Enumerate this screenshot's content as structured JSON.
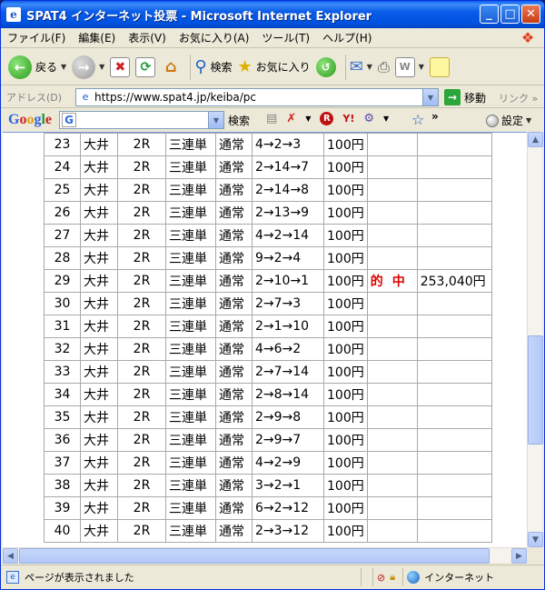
{
  "window": {
    "title": "SPAT4 インターネット投票 - Microsoft Internet Explorer"
  },
  "menubar": {
    "items": [
      "ファイル(F)",
      "編集(E)",
      "表示(V)",
      "お気に入り(A)",
      "ツール(T)",
      "ヘルプ(H)"
    ]
  },
  "toolbar": {
    "back": "戻る",
    "search": "検索",
    "favorites": "お気に入り"
  },
  "address": {
    "label": "アドレス(D)",
    "url": "https://www.spat4.jp/keiba/pc",
    "go": "移動",
    "links": "リンク"
  },
  "google": {
    "logo": "Google",
    "search_button": "検索",
    "settings": "設定"
  },
  "bets": {
    "rows": [
      {
        "num": "23",
        "track": "大井",
        "race": "2R",
        "type": "三連単",
        "mode": "通常",
        "combo": "4→2→3",
        "amount": "100円",
        "hit": "",
        "payout": ""
      },
      {
        "num": "24",
        "track": "大井",
        "race": "2R",
        "type": "三連単",
        "mode": "通常",
        "combo": "2→14→7",
        "amount": "100円",
        "hit": "",
        "payout": ""
      },
      {
        "num": "25",
        "track": "大井",
        "race": "2R",
        "type": "三連単",
        "mode": "通常",
        "combo": "2→14→8",
        "amount": "100円",
        "hit": "",
        "payout": ""
      },
      {
        "num": "26",
        "track": "大井",
        "race": "2R",
        "type": "三連単",
        "mode": "通常",
        "combo": "2→13→9",
        "amount": "100円",
        "hit": "",
        "payout": ""
      },
      {
        "num": "27",
        "track": "大井",
        "race": "2R",
        "type": "三連単",
        "mode": "通常",
        "combo": "4→2→14",
        "amount": "100円",
        "hit": "",
        "payout": ""
      },
      {
        "num": "28",
        "track": "大井",
        "race": "2R",
        "type": "三連単",
        "mode": "通常",
        "combo": "9→2→4",
        "amount": "100円",
        "hit": "",
        "payout": ""
      },
      {
        "num": "29",
        "track": "大井",
        "race": "2R",
        "type": "三連単",
        "mode": "通常",
        "combo": "2→10→1",
        "amount": "100円",
        "hit": "的中",
        "payout": "253,040円"
      },
      {
        "num": "30",
        "track": "大井",
        "race": "2R",
        "type": "三連単",
        "mode": "通常",
        "combo": "2→7→3",
        "amount": "100円",
        "hit": "",
        "payout": ""
      },
      {
        "num": "31",
        "track": "大井",
        "race": "2R",
        "type": "三連単",
        "mode": "通常",
        "combo": "2→1→10",
        "amount": "100円",
        "hit": "",
        "payout": ""
      },
      {
        "num": "32",
        "track": "大井",
        "race": "2R",
        "type": "三連単",
        "mode": "通常",
        "combo": "4→6→2",
        "amount": "100円",
        "hit": "",
        "payout": ""
      },
      {
        "num": "33",
        "track": "大井",
        "race": "2R",
        "type": "三連単",
        "mode": "通常",
        "combo": "2→7→14",
        "amount": "100円",
        "hit": "",
        "payout": ""
      },
      {
        "num": "34",
        "track": "大井",
        "race": "2R",
        "type": "三連単",
        "mode": "通常",
        "combo": "2→8→14",
        "amount": "100円",
        "hit": "",
        "payout": ""
      },
      {
        "num": "35",
        "track": "大井",
        "race": "2R",
        "type": "三連単",
        "mode": "通常",
        "combo": "2→9→8",
        "amount": "100円",
        "hit": "",
        "payout": ""
      },
      {
        "num": "36",
        "track": "大井",
        "race": "2R",
        "type": "三連単",
        "mode": "通常",
        "combo": "2→9→7",
        "amount": "100円",
        "hit": "",
        "payout": ""
      },
      {
        "num": "37",
        "track": "大井",
        "race": "2R",
        "type": "三連単",
        "mode": "通常",
        "combo": "4→2→9",
        "amount": "100円",
        "hit": "",
        "payout": ""
      },
      {
        "num": "38",
        "track": "大井",
        "race": "2R",
        "type": "三連単",
        "mode": "通常",
        "combo": "3→2→1",
        "amount": "100円",
        "hit": "",
        "payout": ""
      },
      {
        "num": "39",
        "track": "大井",
        "race": "2R",
        "type": "三連単",
        "mode": "通常",
        "combo": "6→2→12",
        "amount": "100円",
        "hit": "",
        "payout": ""
      },
      {
        "num": "40",
        "track": "大井",
        "race": "2R",
        "type": "三連単",
        "mode": "通常",
        "combo": "2→3→12",
        "amount": "100円",
        "hit": "",
        "payout": ""
      }
    ]
  },
  "status": {
    "text": "ページが表示されました",
    "zone": "インターネット"
  },
  "colors": {
    "titlebar": "#0053e1",
    "hit_text": "#e00000",
    "chrome": "#ece9d8"
  }
}
